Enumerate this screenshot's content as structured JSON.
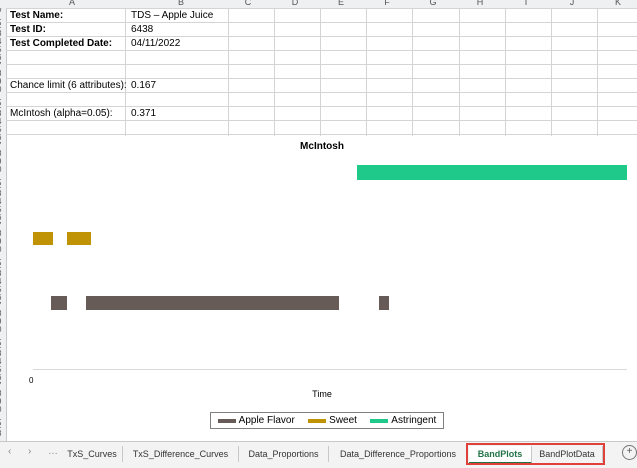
{
  "columns": [
    "A",
    "B",
    "C",
    "D",
    "E",
    "F",
    "G",
    "H",
    "I",
    "J",
    "K"
  ],
  "rows": [
    "0",
    "1",
    "2",
    "3",
    "4",
    "5",
    "6",
    "7",
    "8",
    "9",
    "0",
    "1",
    "2",
    "3",
    "4",
    "5",
    "6",
    "7",
    "8",
    "9",
    "0",
    "1",
    "2",
    "3",
    "4",
    "5",
    "6",
    "7",
    "8",
    "9",
    "0",
    "1",
    "2",
    "3",
    "4",
    "5",
    "6",
    "7",
    "8",
    "9",
    "0",
    "1",
    "2",
    "3",
    "4",
    "5",
    "6",
    "7",
    "8",
    "9",
    "0",
    "1",
    "2",
    "3"
  ],
  "cells": {
    "test_name_label": "Test Name:",
    "test_name_value": "TDS – Apple Juice",
    "test_id_label": "Test ID:",
    "test_id_value": "6438",
    "test_date_label": "Test Completed Date:",
    "test_date_value": "04/11/2022",
    "chance_label": "Chance limit (6 attributes):",
    "chance_value": "0.167",
    "mcintosh_label": "McIntosh (alpha=0.05):",
    "mcintosh_value": "0.371"
  },
  "chart_data": {
    "type": "bar",
    "title": "McIntosh",
    "xlabel": "Time",
    "x_tick_labels": [
      "0"
    ],
    "legend_placement": "bottom",
    "series": [
      {
        "name": "Apple Flavor",
        "color": "#675b58",
        "bands": [
          [
            0.03,
            0.058
          ],
          [
            0.09,
            0.515
          ],
          [
            0.582,
            0.6
          ]
        ]
      },
      {
        "name": "Sweet",
        "color": "#c09306",
        "bands": [
          [
            0.0,
            0.033
          ],
          [
            0.058,
            0.098
          ]
        ]
      },
      {
        "name": "Astringent",
        "color": "#1ec98a",
        "bands": [
          [
            0.545,
            1.0
          ]
        ]
      }
    ]
  },
  "sheet_tabs": [
    {
      "label": "TxS_Curves",
      "active": false
    },
    {
      "label": "TxS_Difference_Curves",
      "active": false
    },
    {
      "label": "Data_Proportions",
      "active": false
    },
    {
      "label": "Data_Difference_Proportions",
      "active": false
    },
    {
      "label": "BandPlots",
      "active": true
    },
    {
      "label": "BandPlotData",
      "active": false
    }
  ],
  "nav": {
    "prev": "‹",
    "next": "›",
    "more": "…",
    "add": "+"
  },
  "colors": {
    "active_tab": "#217346",
    "highlight": "#e0403a"
  }
}
